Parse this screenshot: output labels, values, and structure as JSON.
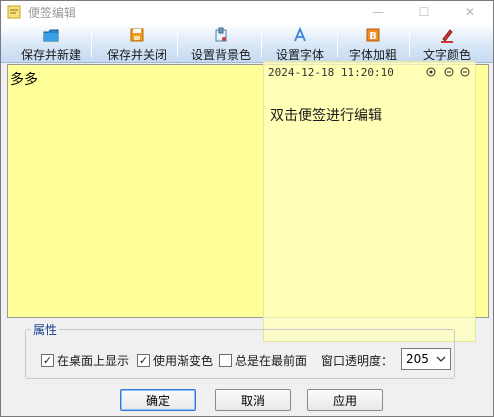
{
  "window": {
    "title": "便签编辑",
    "min_glyph": "—",
    "max_glyph": "☐",
    "close_glyph": "✕"
  },
  "toolbar": {
    "save_new": "保存并新建",
    "save_close": "保存并关闭",
    "set_bg": "设置背景色",
    "set_font": "设置字体",
    "bold": "字体加粗",
    "text_color": "文字颜色"
  },
  "note": {
    "content": "多多",
    "background": "#ffff99"
  },
  "preview": {
    "timestamp": "2024-12-18 11:20:10",
    "hint": "双击便签进行编辑"
  },
  "properties": {
    "legend": "属性",
    "show_desktop": {
      "label": "在桌面上显示",
      "checked": true
    },
    "use_gradient": {
      "label": "使用渐变色",
      "checked": true
    },
    "always_top": {
      "label": "总是在最前面",
      "checked": false
    },
    "opacity_label": "窗口透明度：",
    "opacity_value": "205"
  },
  "buttons": {
    "ok": "确定",
    "cancel": "取消",
    "apply": "应用"
  },
  "colors": {
    "accent": "#2f7bd6",
    "legend": "#1a3e8c"
  }
}
